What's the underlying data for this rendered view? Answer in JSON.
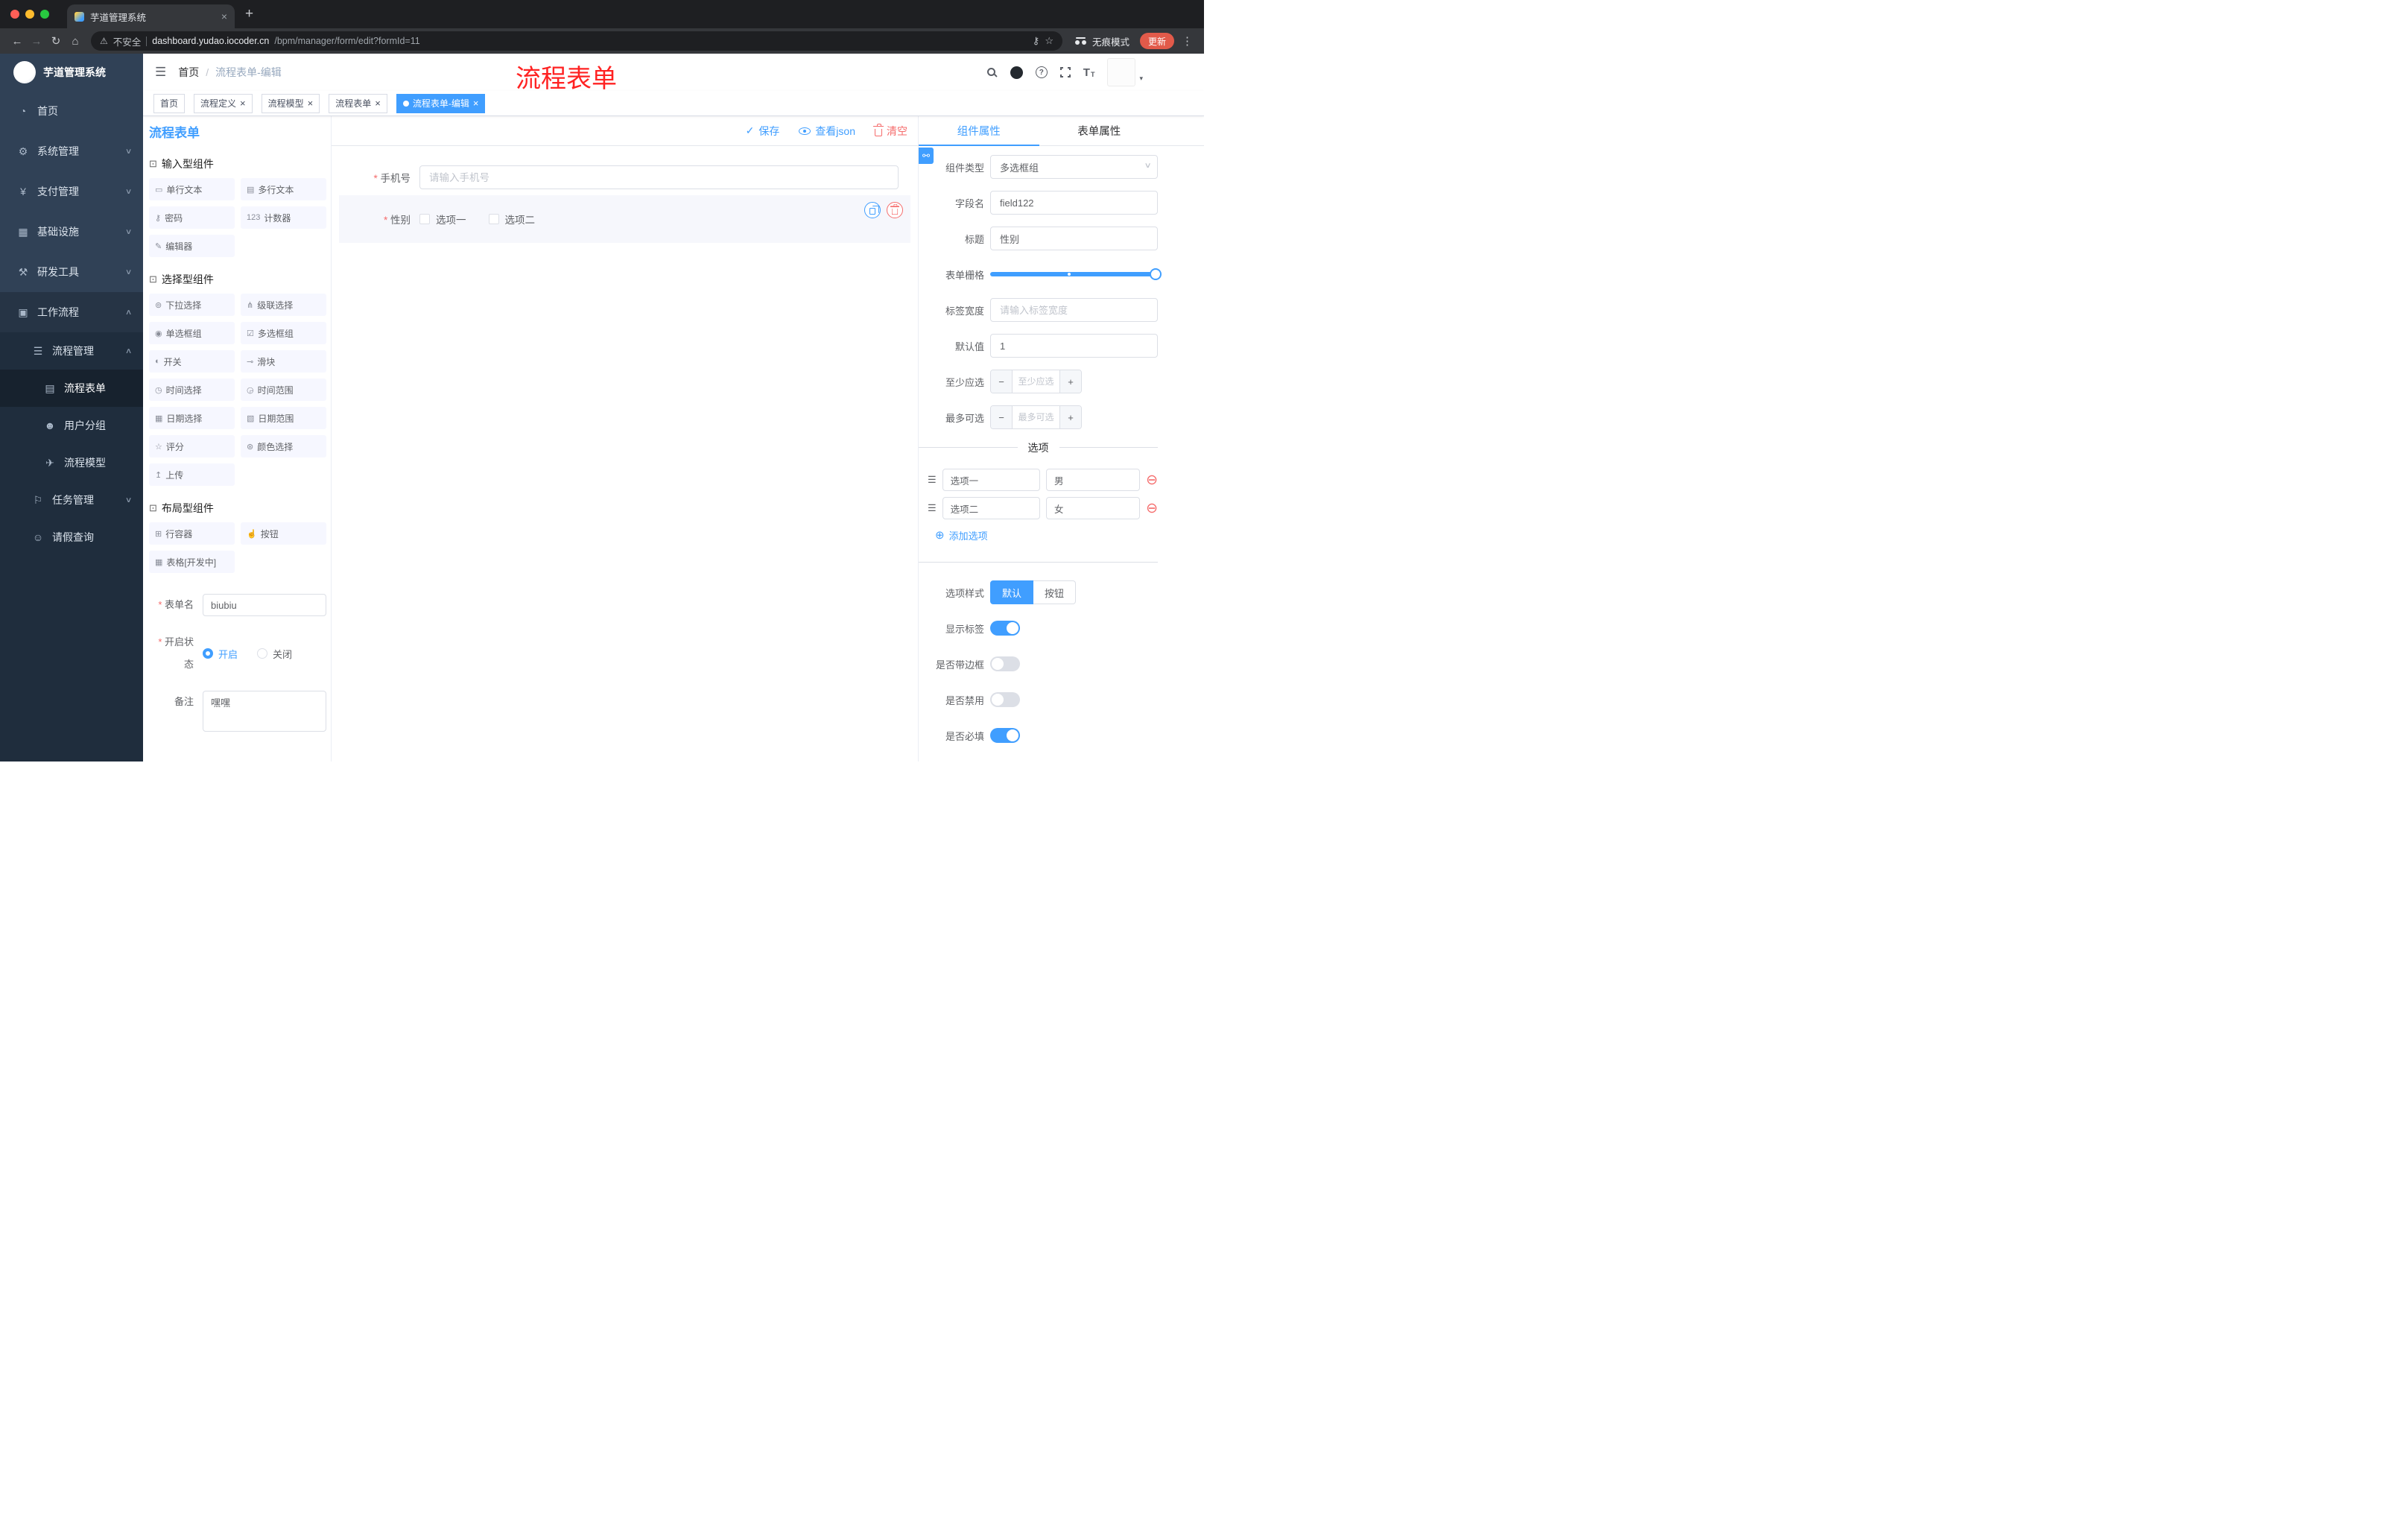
{
  "ui": {
    "close": "×",
    "back": "←",
    "forward": "→",
    "reload": "↻",
    "home": "⌂",
    "warning": "⚠",
    "key": "⚷",
    "star": "☆",
    "dots": "⋮",
    "new_tab": "+",
    "hamburger": "☰",
    "caret": "▾",
    "check": "✓",
    "select_caret": "∨",
    "minus": "−",
    "plus": "+",
    "remove": "⊖",
    "add": "⊕",
    "drag": "☰",
    "link": "⚯"
  },
  "browser": {
    "tab_title": "芋道管理系统",
    "security_label": "不安全",
    "url_domain": "dashboard.yudao.iocoder.cn",
    "url_path": "/bpm/manager/form/edit?formId=11",
    "incognito_label": "无痕模式",
    "update_label": "更新"
  },
  "sidebar": {
    "logo_title": "芋道管理系统",
    "items": [
      {
        "label": "首页",
        "icon": "◔",
        "chevron": ""
      },
      {
        "label": "系统管理",
        "icon": "⚙",
        "chevron": "∨"
      },
      {
        "label": "支付管理",
        "icon": "¥",
        "chevron": "∨"
      },
      {
        "label": "基础设施",
        "icon": "▦",
        "chevron": "∨"
      },
      {
        "label": "研发工具",
        "icon": "⚒",
        "chevron": "∨"
      },
      {
        "label": "工作流程",
        "icon": "▣",
        "chevron": "∧"
      },
      {
        "label": "流程管理",
        "icon": "☰",
        "chevron": "∧"
      },
      {
        "label": "流程表单",
        "icon": "▤",
        "chevron": ""
      },
      {
        "label": "用户分组",
        "icon": "☻",
        "chevron": ""
      },
      {
        "label": "流程模型",
        "icon": "✈",
        "chevron": ""
      },
      {
        "label": "任务管理",
        "icon": "⚐",
        "chevron": "∨"
      },
      {
        "label": "请假查询",
        "icon": "☺",
        "chevron": ""
      }
    ]
  },
  "header": {
    "breadcrumb_home": "首页",
    "breadcrumb_sep": "/",
    "breadcrumb_current": "流程表单-编辑",
    "annotation": "流程表单"
  },
  "tags": [
    {
      "label": "首页"
    },
    {
      "label": "流程定义"
    },
    {
      "label": "流程模型"
    },
    {
      "label": "流程表单"
    },
    {
      "label": "流程表单-编辑"
    }
  ],
  "toolbar": {
    "page_title": "流程表单",
    "save_label": "保存",
    "view_json_label": "查看json",
    "clear_label": "清空"
  },
  "palette": {
    "groups": [
      {
        "title": "输入型组件",
        "icon": "⊡",
        "items": [
          {
            "label": "单行文本",
            "icon": "▭"
          },
          {
            "label": "多行文本",
            "icon": "▤"
          },
          {
            "label": "密码",
            "icon": "⚷"
          },
          {
            "label": "计数器",
            "icon": "123"
          },
          {
            "label": "编辑器",
            "icon": "✎"
          }
        ]
      },
      {
        "title": "选择型组件",
        "icon": "⊡",
        "items": [
          {
            "label": "下拉选择",
            "icon": "⊚"
          },
          {
            "label": "级联选择",
            "icon": "⋔"
          },
          {
            "label": "单选框组",
            "icon": "◉"
          },
          {
            "label": "多选框组",
            "icon": "☑"
          },
          {
            "label": "开关",
            "icon": "◐"
          },
          {
            "label": "滑块",
            "icon": "⊸"
          },
          {
            "label": "时间选择",
            "icon": "◷"
          },
          {
            "label": "时间范围",
            "icon": "◶"
          },
          {
            "label": "日期选择",
            "icon": "▦"
          },
          {
            "label": "日期范围",
            "icon": "▧"
          },
          {
            "label": "评分",
            "icon": "☆"
          },
          {
            "label": "颜色选择",
            "icon": "⊛"
          },
          {
            "label": "上传",
            "icon": "↥"
          }
        ]
      },
      {
        "title": "布局型组件",
        "icon": "⊡",
        "items": [
          {
            "label": "行容器",
            "icon": "⊞"
          },
          {
            "label": "按钮",
            "icon": "☝"
          },
          {
            "label": "表格[开发中]",
            "icon": "▦"
          }
        ]
      }
    ],
    "form": {
      "name_label": "表单名",
      "name_value": "biubiu",
      "status_label": "开启状态",
      "status_on": "开启",
      "status_off": "关闭",
      "remark_label": "备注",
      "remark_value": "嘿嘿"
    }
  },
  "canvas": {
    "phone_label": "手机号",
    "phone_placeholder": "请输入手机号",
    "gender_label": "性别",
    "gender_opt1": "选项一",
    "gender_opt2": "选项二"
  },
  "props": {
    "tab_component": "组件属性",
    "tab_form": "表单属性",
    "type_label": "组件类型",
    "type_value": "多选框组",
    "field_label": "字段名",
    "field_value": "field122",
    "title_label": "标题",
    "title_value": "性别",
    "grid_label": "表单栅格",
    "labelwidth_label": "标签宽度",
    "labelwidth_placeholder": "请输入标签宽度",
    "default_label": "默认值",
    "default_value": "1",
    "min_label": "至少应选",
    "min_placeholder": "至少应选",
    "max_label": "最多可选",
    "max_placeholder": "最多可选",
    "options_divider": "选项",
    "options": [
      {
        "label": "选项一",
        "value": "男"
      },
      {
        "label": "选项二",
        "value": "女"
      }
    ],
    "add_option": "添加选项",
    "style_label": "选项样式",
    "style_default": "默认",
    "style_button": "按钮",
    "show_label": "显示标签",
    "border_label": "是否带边框",
    "disabled_label": "是否禁用",
    "required_label": "是否必填"
  }
}
